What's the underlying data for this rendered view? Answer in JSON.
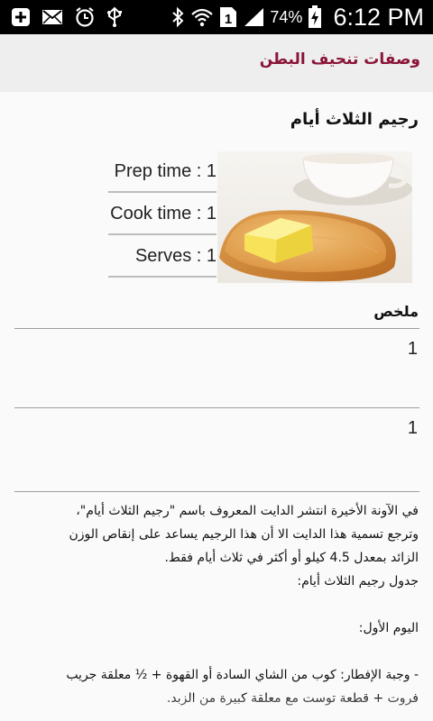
{
  "status_bar": {
    "battery_percent": "74%",
    "time": "6:12 PM",
    "sim_slot": "1",
    "icons": [
      "add-icon",
      "email-icon",
      "alarm-clock-icon",
      "usb-icon",
      "bluetooth-icon",
      "wifi-icon",
      "sim-1-icon",
      "signal-icon",
      "battery-charging-icon"
    ]
  },
  "app_bar": {
    "title": "وصفات تنحيف البطن"
  },
  "recipe": {
    "title": "رجيم الثلاث أيام",
    "image_icon": "toast-with-butter-image",
    "prep_time": "Prep time : 1",
    "cook_time": "Cook time : 1",
    "serves": "Serves : 1"
  },
  "summary": {
    "heading": "ملخص",
    "items": [
      "1",
      "1"
    ]
  },
  "body": {
    "paragraph1_line1": "في الآونة الأخيرة انتشر الدايت المعروف باسم \"رجيم الثلاث أيام\"،",
    "paragraph1_line2": "وترجع تسمية هذا الدايت الا أن هذا الرجيم يساعد على إنقاص الوزن",
    "paragraph1_line3": "الزائد بمعدل 4.5 كيلو أو أكثر في ثلاث أيام فقط.",
    "schedule_title": "جدول رجيم الثلاث أيام:",
    "day1": "اليوم الأول:",
    "breakfast_line1": "- وجبة الإفطار: كوب من الشاي السادة أو القهوة + ½ معلقة جريب",
    "breakfast_line2": "فروت + قطعة توست مع معلقة كبيرة من الزبد."
  }
}
